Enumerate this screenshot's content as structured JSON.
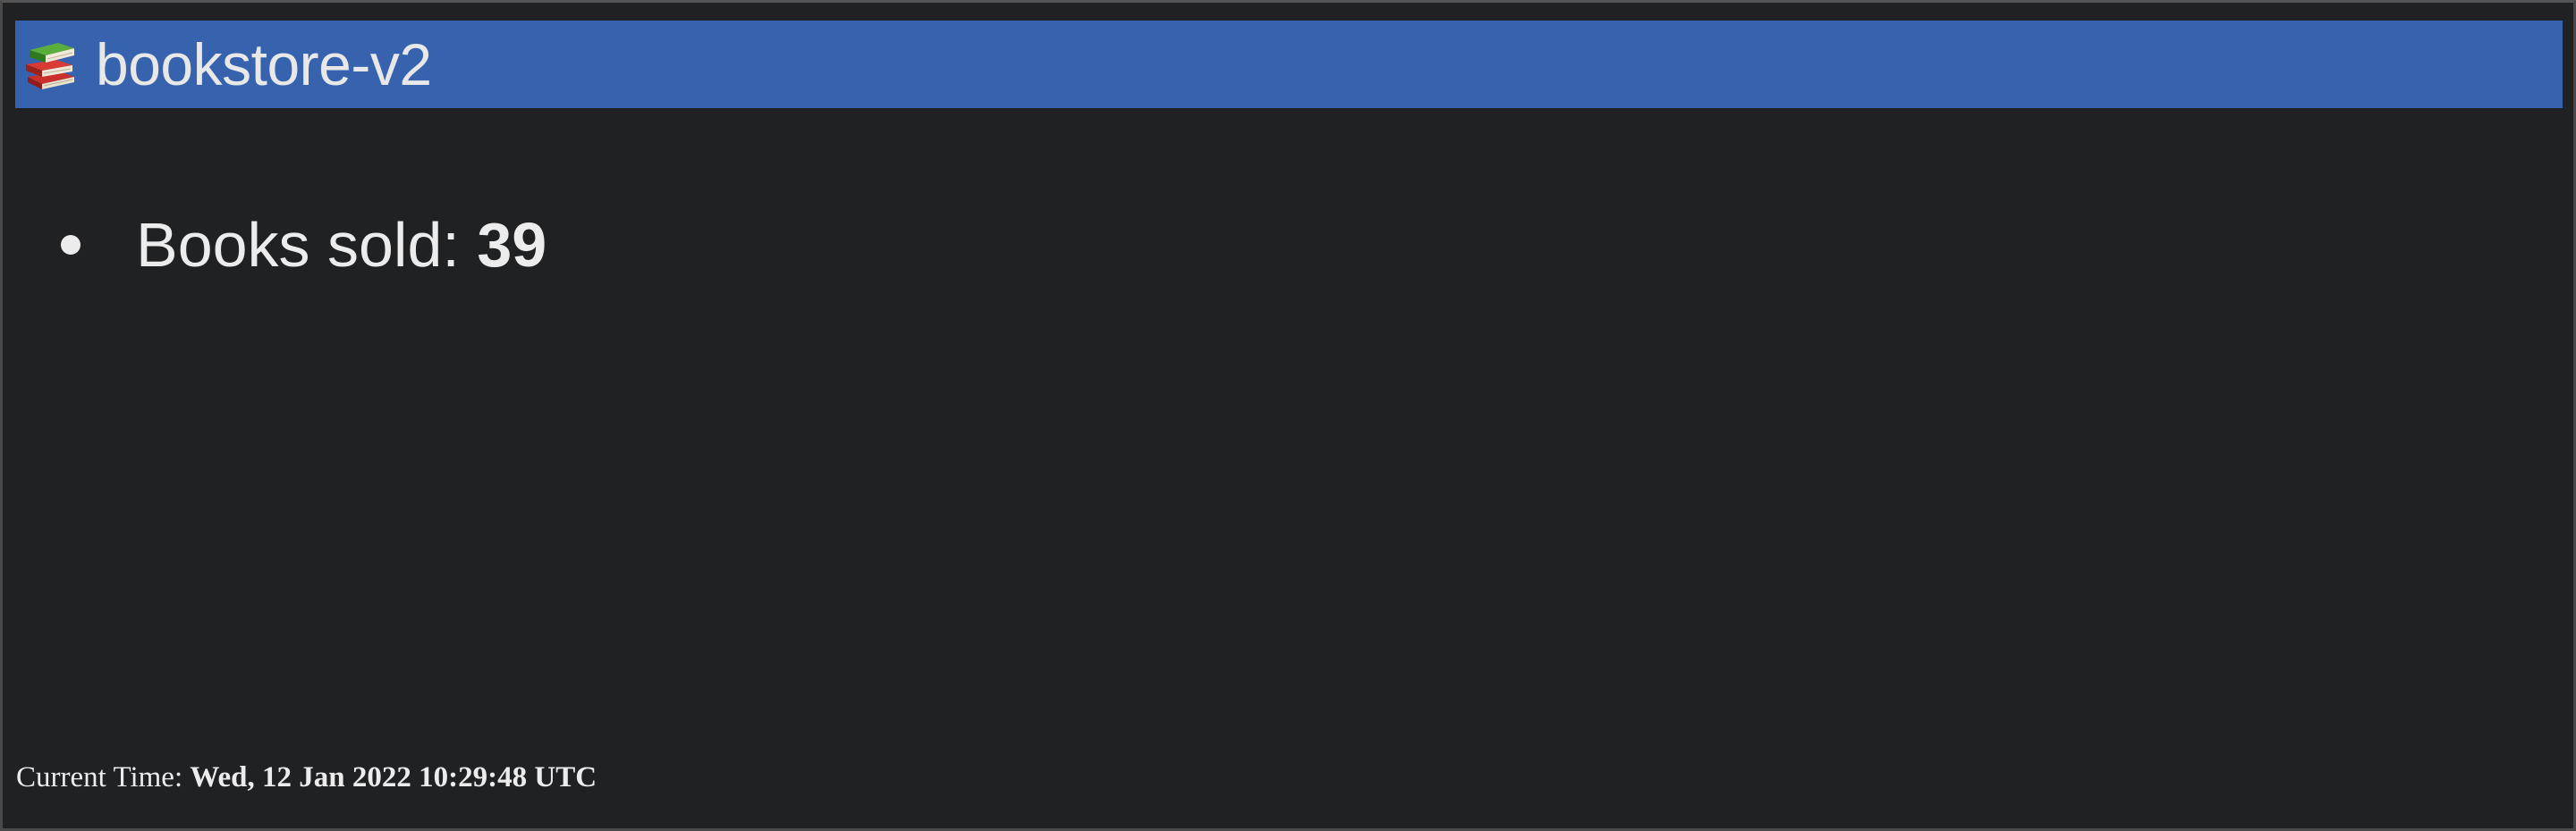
{
  "header": {
    "title": "bookstore-v2",
    "icon": "books-stack-icon",
    "background_color": "#3762ad"
  },
  "stats": {
    "items": [
      {
        "label": "Books sold: ",
        "value": "39"
      }
    ]
  },
  "footer": {
    "label": "Current Time: ",
    "value": "Wed, 12 Jan 2022 10:29:48 UTC"
  }
}
